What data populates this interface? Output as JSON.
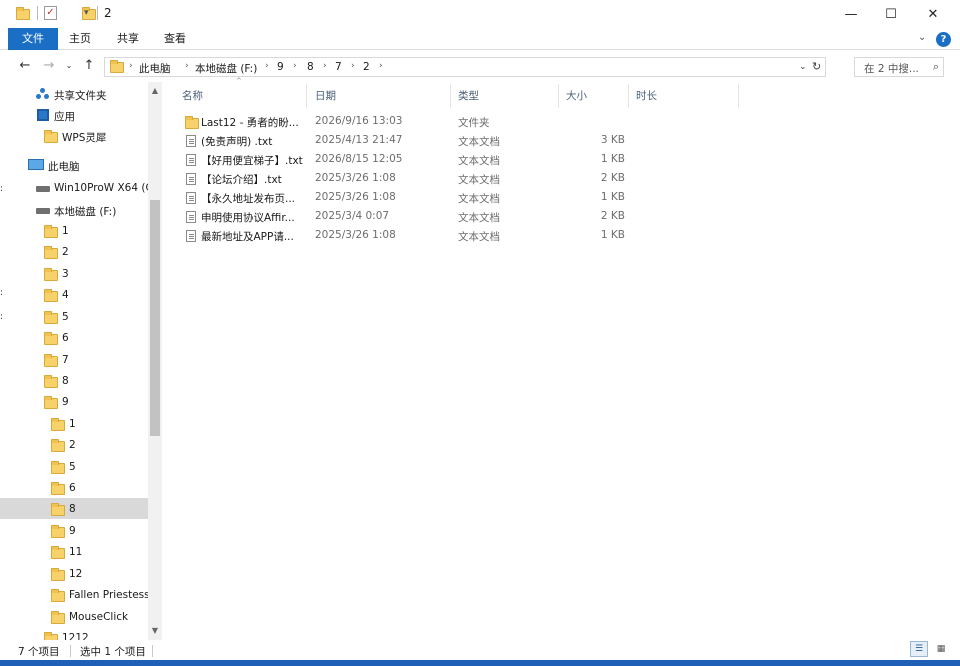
{
  "window": {
    "title": "2",
    "icons": [
      "folder-icon",
      "properties-icon",
      "new-folder-icon"
    ],
    "controls": [
      "minimize",
      "maximize",
      "close"
    ]
  },
  "ribbon": {
    "tabs": [
      "文件",
      "主页",
      "共享",
      "查看"
    ],
    "active_tab": "文件",
    "accent_color": "#1a6fc4"
  },
  "address": {
    "path": [
      "此电脑",
      "本地磁盘 (F:)",
      "9",
      "8",
      "7",
      "2"
    ],
    "search_placeholder": "在 2 中搜..."
  },
  "sidebar": {
    "items": [
      {
        "label": "共享文件夹",
        "icon": "network-icon"
      },
      {
        "label": "应用",
        "icon": "app-icon"
      },
      {
        "label": "WPS灵犀",
        "icon": "folder-icon"
      },
      {
        "label": "此电脑",
        "icon": "pc-icon"
      },
      {
        "label": "Win10ProW X64 (C",
        "icon": "drive-icon"
      },
      {
        "label": "本地磁盘 (F:)",
        "icon": "drive-icon"
      },
      {
        "label": "1",
        "icon": "folder-icon"
      },
      {
        "label": "2",
        "icon": "folder-icon"
      },
      {
        "label": "3",
        "icon": "folder-icon"
      },
      {
        "label": "4",
        "icon": "folder-icon"
      },
      {
        "label": "5",
        "icon": "folder-icon"
      },
      {
        "label": "6",
        "icon": "folder-icon"
      },
      {
        "label": "7",
        "icon": "folder-icon"
      },
      {
        "label": "8",
        "icon": "folder-icon"
      },
      {
        "label": "9",
        "icon": "folder-icon"
      },
      {
        "label": "1",
        "icon": "folder-icon"
      },
      {
        "label": "2",
        "icon": "folder-icon"
      },
      {
        "label": "5",
        "icon": "folder-icon"
      },
      {
        "label": "6",
        "icon": "folder-icon"
      },
      {
        "label": "8",
        "icon": "folder-icon",
        "selected": true
      },
      {
        "label": "9",
        "icon": "folder-icon"
      },
      {
        "label": "11",
        "icon": "folder-icon"
      },
      {
        "label": "12",
        "icon": "folder-icon"
      },
      {
        "label": "Fallen Priestess",
        "icon": "folder-icon"
      },
      {
        "label": "MouseClick",
        "icon": "folder-icon"
      },
      {
        "label": "1212",
        "icon": "folder-icon"
      }
    ]
  },
  "columns": {
    "name": "名称",
    "date": "日期",
    "type": "类型",
    "size": "大小",
    "duration": "时长"
  },
  "files": [
    {
      "name": "Last12 - 勇者的盼...",
      "date": "2026/9/16 13:03",
      "type": "文件夹",
      "size": "",
      "icon": "folder-icon"
    },
    {
      "name": "(免责声明) .txt",
      "date": "2025/4/13 21:47",
      "type": "文本文档",
      "size": "3 KB",
      "icon": "text-file-icon"
    },
    {
      "name": "【好用便宜梯子】.txt",
      "date": "2026/8/15 12:05",
      "type": "文本文档",
      "size": "1 KB",
      "icon": "text-file-icon"
    },
    {
      "name": "【论坛介绍】.txt",
      "date": "2025/3/26 1:08",
      "type": "文本文档",
      "size": "2 KB",
      "icon": "text-file-icon"
    },
    {
      "name": "【永久地址发布页...",
      "date": "2025/3/26 1:08",
      "type": "文本文档",
      "size": "1 KB",
      "icon": "text-file-icon"
    },
    {
      "name": "申明使用协议Affir...",
      "date": "2025/3/4 0:07",
      "type": "文本文档",
      "size": "2 KB",
      "icon": "text-file-icon"
    },
    {
      "name": "最新地址及APP请...",
      "date": "2025/3/26 1:08",
      "type": "文本文档",
      "size": "1 KB",
      "icon": "text-file-icon"
    }
  ],
  "status": {
    "item_count": "7 个项目",
    "selected": "选中 1 个项目"
  },
  "colors": {
    "folder": "#f7d26a",
    "selection": "#d9d9d9",
    "header_text": "#4c607a",
    "taskbar": "#1f5fb8"
  }
}
